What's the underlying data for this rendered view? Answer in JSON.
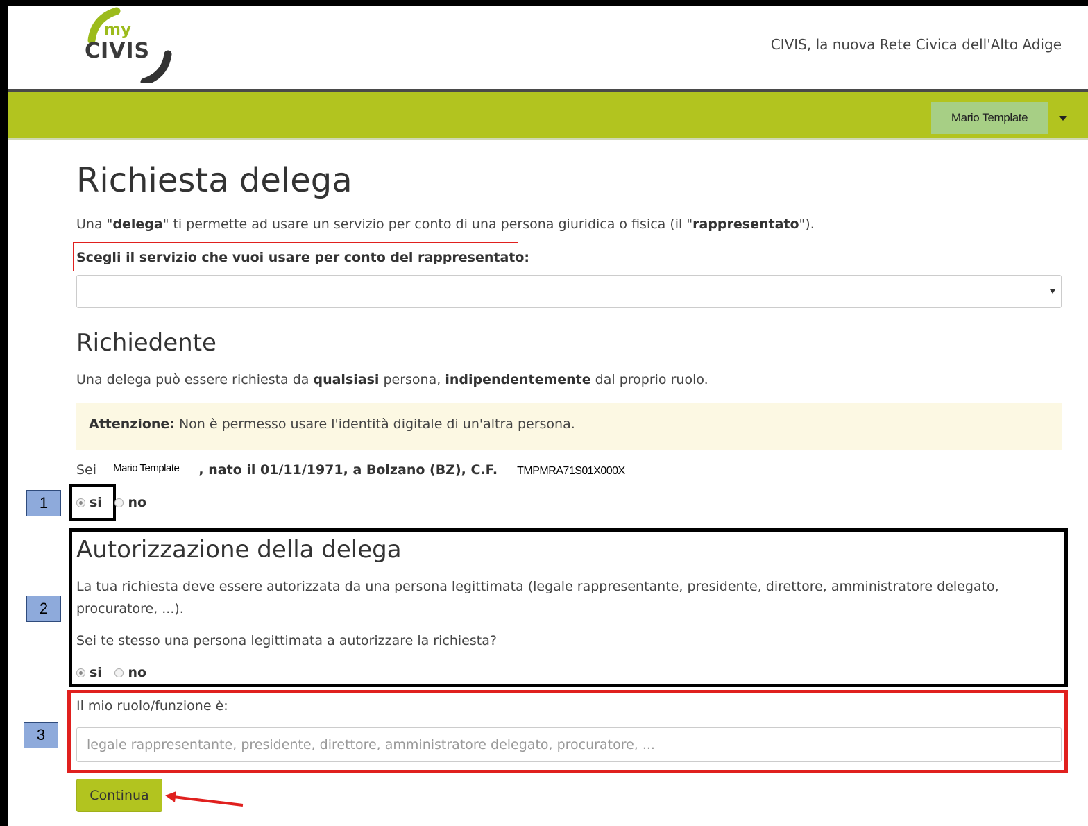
{
  "header": {
    "logo_my": "my",
    "logo_civis": "CIVIS",
    "tagline": "CIVIS, la nuova Rete Civica dell'Alto Adige"
  },
  "user_menu": {
    "name": "Mario Template"
  },
  "page": {
    "title": "Richiesta delega",
    "intro_parts": [
      "Una \"",
      "delega",
      "\" ti permette ad usare un servizio per conto di una persona giuridica o fisica (il \"",
      "rappresentato",
      "\")."
    ],
    "service_label": "Scegli il servizio che vuoi usare per conto del rappresentato:",
    "service_select_value": ""
  },
  "richiedente": {
    "heading": "Richiedente",
    "desc_parts": [
      "Una delega può essere richiesta da ",
      "qualsiasi",
      " persona, ",
      "indipendentemente",
      " dal proprio ruolo."
    ],
    "alert_bold": "Attenzione:",
    "alert_text": " Non è permesso usare l'identità digitale di un'altra persona.",
    "sei_prefix": "Sei",
    "name": "Mario Template",
    "birth_info": ", nato il 01/11/1971, a Bolzano (BZ), C.F.",
    "codice_fiscale": "TMPMRA71S01X000X",
    "options": [
      {
        "label": "si",
        "checked": true
      },
      {
        "label": "no",
        "checked": false
      }
    ]
  },
  "autorizzazione": {
    "heading": "Autorizzazione della delega",
    "desc_line1": "La tua richiesta deve essere autorizzata da una persona legittimata (legale rappresentante, presidente, direttore, amministratore delegato,",
    "desc_line2": "procuratore, ...).",
    "question": "Sei te stesso una persona legittimata a autorizzare la richiesta?",
    "options": [
      {
        "label": "si",
        "checked": true
      },
      {
        "label": "no",
        "checked": false
      }
    ]
  },
  "ruolo": {
    "label": "Il mio ruolo/funzione è:",
    "placeholder": "legale rappresentante, presidente, direttore, amministratore delegato, procuratore, ...",
    "value": ""
  },
  "submit_label": "Continua",
  "annotations": [
    "1",
    "2",
    "3"
  ],
  "colors": {
    "brand_green": "#b2c41f",
    "user_button": "#a7cf85",
    "annotation_blue": "#8eaadb",
    "highlight_red": "#e0201e",
    "alert_bg": "#fcf8e3"
  }
}
